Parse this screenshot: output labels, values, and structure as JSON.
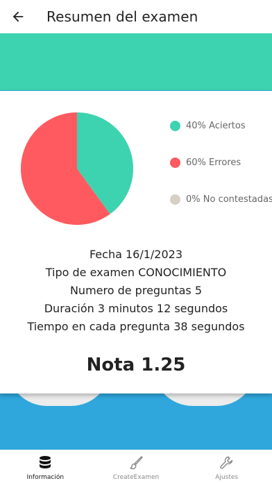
{
  "appbar": {
    "title": "Resumen del examen",
    "back_icon": "arrow-back-icon"
  },
  "colors": {
    "teal": "#3dd3b0",
    "red": "#ff5a5f",
    "gray": "#d6cfc4",
    "blue": "#2fa7dc"
  },
  "chart_data": {
    "type": "pie",
    "slices": [
      {
        "label": "40% Aciertos",
        "value": 40,
        "color": "#3dd3b0"
      },
      {
        "label": "60% Errores",
        "value": 60,
        "color": "#ff5a5f"
      },
      {
        "label": "0% No contestadas",
        "value": 0,
        "color": "#d6cfc4"
      }
    ]
  },
  "info": {
    "fecha": "Fecha 16/1/2023",
    "tipo": "Tipo de examen CONOCIMIENTO",
    "preguntas": "Numero de preguntas 5",
    "duracion": "Duración 3 minutos 12 segundos",
    "tiempo": "Tiempo en cada pregunta 38 segundos"
  },
  "grade": "Nota 1.25",
  "bottom_nav": {
    "items": [
      {
        "label": "Información",
        "icon": "database-icon",
        "active": true
      },
      {
        "label": "CreateExamen",
        "icon": "brush-icon",
        "active": false
      },
      {
        "label": "Ajustes",
        "icon": "wrench-icon",
        "active": false
      }
    ]
  }
}
